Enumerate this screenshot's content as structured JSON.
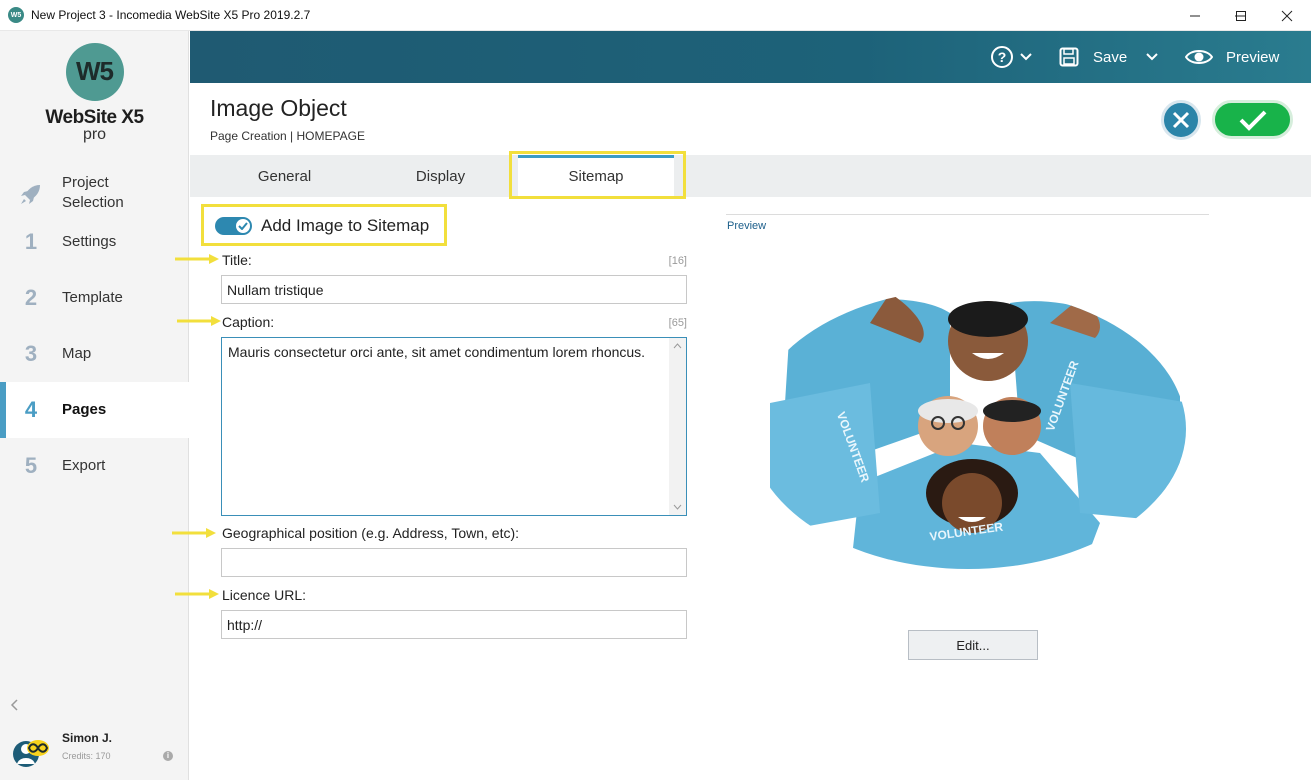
{
  "window": {
    "title": "New Project 3 - Incomedia WebSite X5 Pro 2019.2.7",
    "app_icon": "W5"
  },
  "sidebar": {
    "logo": {
      "mark": "W5",
      "name": "WebSite X5",
      "edition": "pro"
    },
    "items": [
      {
        "num": "",
        "label": "Project\nSelection",
        "icon": "rocket-icon",
        "active": false
      },
      {
        "num": "1",
        "label": "Settings",
        "active": false
      },
      {
        "num": "2",
        "label": "Template",
        "active": false
      },
      {
        "num": "3",
        "label": "Map",
        "active": false
      },
      {
        "num": "4",
        "label": "Pages",
        "active": true
      },
      {
        "num": "5",
        "label": "Export",
        "active": false
      }
    ],
    "user": {
      "name": "Simon J.",
      "credits": "Credits: 170"
    }
  },
  "toolbar": {
    "help_label": "?",
    "save_label": "Save",
    "preview_label": "Preview"
  },
  "header": {
    "title": "Image Object",
    "breadcrumb": "Page Creation | HOMEPAGE"
  },
  "tabs": [
    {
      "label": "General",
      "active": false
    },
    {
      "label": "Display",
      "active": false
    },
    {
      "label": "Sitemap",
      "active": true
    }
  ],
  "sitemap": {
    "toggle_label": "Add Image to Sitemap",
    "toggle_on": true,
    "title_label": "Title:",
    "title_count": "[16]",
    "title_value": "Nullam tristique",
    "caption_label": "Caption:",
    "caption_count": "[65]",
    "caption_value": "Mauris consectetur orci ante, sit amet condimentum lorem rhoncus.",
    "geo_label": "Geographical position (e.g. Address, Town, etc):",
    "geo_value": "",
    "licence_label": "Licence URL:",
    "licence_value": "http://"
  },
  "preview": {
    "label": "Preview",
    "image_text": "VOLUNTEER",
    "edit_label": "Edit..."
  },
  "colors": {
    "accent": "#2d88b0",
    "highlight": "#f2df3c",
    "confirm": "#18b34a",
    "topbar": "#1f5a72"
  }
}
